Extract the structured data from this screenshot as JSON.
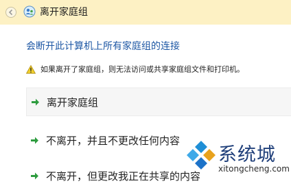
{
  "window": {
    "title": "离开家庭组"
  },
  "content": {
    "heading": "会断开此计算机上所有家庭组的连接",
    "warning": "如果离开了家庭组，则无法访问或共享家庭组文件和打印机。",
    "options": [
      {
        "label": "离开家庭组",
        "icon": "green-arrow-icon",
        "selected": true
      },
      {
        "label": "不离开，并且不更改任何内容",
        "icon": "green-arrow-icon"
      },
      {
        "label": "不离开，但更改我正在共享的内容",
        "icon": "green-arrow-icon"
      }
    ]
  },
  "watermark": {
    "brand": "系统城",
    "url": "xitongcheng.com"
  },
  "colors": {
    "titlebar": "#fdf1c4",
    "heading": "#1d57a4",
    "arrow": "#2e9c3f",
    "warning": "#e8c21d"
  }
}
